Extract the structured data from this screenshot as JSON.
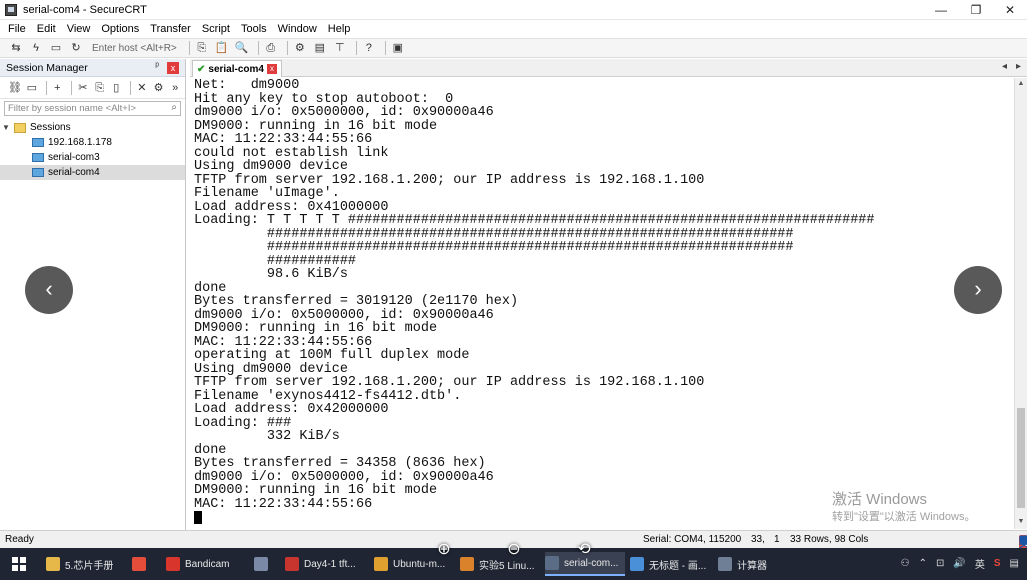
{
  "window": {
    "title": "serial-com4 - SecureCRT",
    "minimize_glyph": "—",
    "restore_glyph": "❐",
    "close_glyph": "✕"
  },
  "menu": [
    "File",
    "Edit",
    "View",
    "Options",
    "Transfer",
    "Script",
    "Tools",
    "Window",
    "Help"
  ],
  "toolbar": {
    "host_placeholder": "Enter host <Alt+R>"
  },
  "session_manager": {
    "title": "Session Manager",
    "pin_glyph": "📌",
    "close_glyph": "x",
    "filter_placeholder": "Filter by session name <Alt+I>",
    "tree": {
      "root": "Sessions",
      "items": [
        "192.168.1.178",
        "serial-com3",
        "serial-com4"
      ],
      "selected": "serial-com4"
    }
  },
  "tab": {
    "label": "serial-com4",
    "close_glyph": "x",
    "prev_glyph": "◂",
    "next_glyph": "▸"
  },
  "terminal": {
    "lines": [
      "Net:   dm9000",
      "Hit any key to stop autoboot:  0",
      "dm9000 i/o: 0x5000000, id: 0x90000a46",
      "DM9000: running in 16 bit mode",
      "MAC: 11:22:33:44:55:66",
      "could not establish link",
      "Using dm9000 device",
      "TFTP from server 192.168.1.200; our IP address is 192.168.1.100",
      "Filename 'uImage'.",
      "Load address: 0x41000000",
      "Loading: T T T T T #################################################################",
      "         #################################################################",
      "         #################################################################",
      "         ###########",
      "         98.6 KiB/s",
      "done",
      "Bytes transferred = 3019120 (2e1170 hex)",
      "dm9000 i/o: 0x5000000, id: 0x90000a46",
      "DM9000: running in 16 bit mode",
      "MAC: 11:22:33:44:55:66",
      "operating at 100M full duplex mode",
      "Using dm9000 device",
      "TFTP from server 192.168.1.200; our IP address is 192.168.1.100",
      "Filename 'exynos4412-fs4412.dtb'.",
      "Load address: 0x42000000",
      "Loading: ###",
      "         332 KiB/s",
      "done",
      "Bytes transferred = 34358 (8636 hex)",
      "dm9000 i/o: 0x5000000, id: 0x90000a46",
      "DM9000: running in 16 bit mode",
      "MAC: 11:22:33:44:55:66"
    ],
    "watermark_title": "激活 Windows",
    "watermark_sub": "转到\"设置\"以激活 Windows。"
  },
  "nav": {
    "prev_glyph": "‹",
    "next_glyph": "›"
  },
  "status": {
    "left": "Ready",
    "connection": "Serial: COM4, 115200",
    "row": "33,",
    "col": "1",
    "size": "33 Rows, 98 Cols",
    "ime_lang": "英"
  },
  "taskbar": {
    "items": [
      {
        "label": "5.芯片手册",
        "color": "#e6b84a"
      },
      {
        "label": "",
        "color": "#e44d3a"
      },
      {
        "label": "Bandicam",
        "color": "#d8362c"
      },
      {
        "label": "",
        "color": "#7a8aa6"
      },
      {
        "label": "Day4-1 tft...",
        "color": "#c8352f"
      },
      {
        "label": "Ubuntu-m...",
        "color": "#e0a030"
      },
      {
        "label": "实验5 Linu...",
        "color": "#d9822b"
      },
      {
        "label": "serial-com...",
        "color": "#5b6d86"
      },
      {
        "label": "无标题 - 画...",
        "color": "#4a90d9"
      },
      {
        "label": "计算器",
        "color": "#6f7f95"
      }
    ],
    "tray_lang": "英",
    "overlay_zoom_in": "⊕",
    "overlay_zoom_out": "⊖",
    "overlay_rotate": "⟲"
  }
}
